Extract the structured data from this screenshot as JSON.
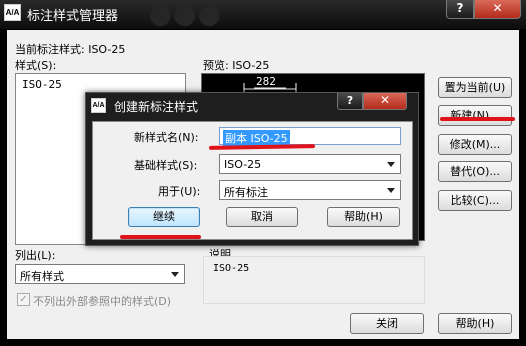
{
  "window": {
    "title": "标注样式管理器",
    "icon_text": "A/A",
    "help_label": "?",
    "close_label": "✕"
  },
  "main": {
    "current_style_label": "当前标注样式: ISO-25",
    "styles_label": "样式(S):",
    "styles": [
      "ISO-25"
    ],
    "preview_label": "预览: ISO-25",
    "preview_dimension": "282",
    "list_label": "列出(L):",
    "list_value": "所有样式",
    "exclude_xref_label": "不列出外部参照中的样式(D)",
    "description_label": "说明",
    "description_value": "ISO-25"
  },
  "buttons": {
    "set_current": "置为当前(U)",
    "new": "新建(N)...",
    "modify": "修改(M)...",
    "override": "替代(O)...",
    "compare": "比较(C)...",
    "close": "关闭",
    "help": "帮助(H)"
  },
  "dialog": {
    "title": "创建新标注样式",
    "icon_text": "A/A",
    "help_label": "?",
    "close_label": "✕",
    "name_label": "新样式名(N):",
    "name_value": "副本 ISO-25",
    "base_label": "基础样式(S):",
    "base_value": "ISO-25",
    "use_for_label": "用于(U):",
    "use_for_value": "所有标注",
    "continue_label": "继续",
    "cancel_label": "取消",
    "help_button_label": "帮助(H)"
  },
  "colors": {
    "annotation_red": "#e0131a",
    "selection_blue": "#3399ff"
  }
}
